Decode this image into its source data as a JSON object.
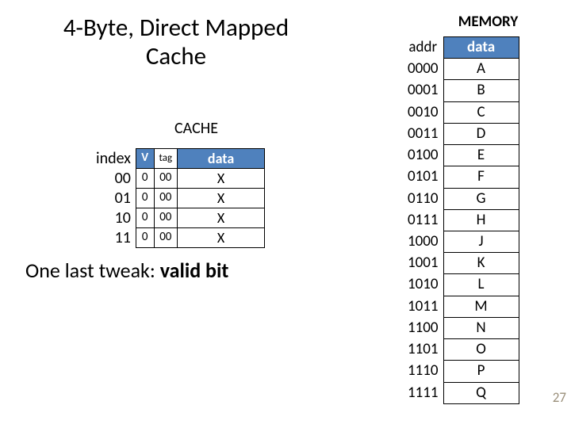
{
  "title": "4-Byte, Direct Mapped Cache",
  "cache_label": "CACHE",
  "cache": {
    "headers": {
      "index": "index",
      "v": "V",
      "tag": "tag",
      "data": "data"
    },
    "rows": [
      {
        "index": "00",
        "v": "0",
        "tag": "00",
        "data": "X"
      },
      {
        "index": "01",
        "v": "0",
        "tag": "00",
        "data": "X"
      },
      {
        "index": "10",
        "v": "0",
        "tag": "00",
        "data": "X"
      },
      {
        "index": "11",
        "v": "0",
        "tag": "00",
        "data": "X"
      }
    ]
  },
  "tweak_prefix": "One last tweak: ",
  "tweak_bold": "valid bit",
  "memory_label": "MEMORY",
  "memory": {
    "headers": {
      "addr": "addr",
      "data": "data"
    },
    "rows": [
      {
        "addr": "0000",
        "data": "A"
      },
      {
        "addr": "0001",
        "data": "B"
      },
      {
        "addr": "0010",
        "data": "C"
      },
      {
        "addr": "0011",
        "data": "D"
      },
      {
        "addr": "0100",
        "data": "E"
      },
      {
        "addr": "0101",
        "data": "F"
      },
      {
        "addr": "0110",
        "data": "G"
      },
      {
        "addr": "0111",
        "data": "H"
      },
      {
        "addr": "1000",
        "data": "J"
      },
      {
        "addr": "1001",
        "data": "K"
      },
      {
        "addr": "1010",
        "data": "L"
      },
      {
        "addr": "1011",
        "data": "M"
      },
      {
        "addr": "1100",
        "data": "N"
      },
      {
        "addr": "1101",
        "data": "O"
      },
      {
        "addr": "1110",
        "data": "P"
      },
      {
        "addr": "1111",
        "data": "Q"
      }
    ]
  },
  "pagenum": "27"
}
